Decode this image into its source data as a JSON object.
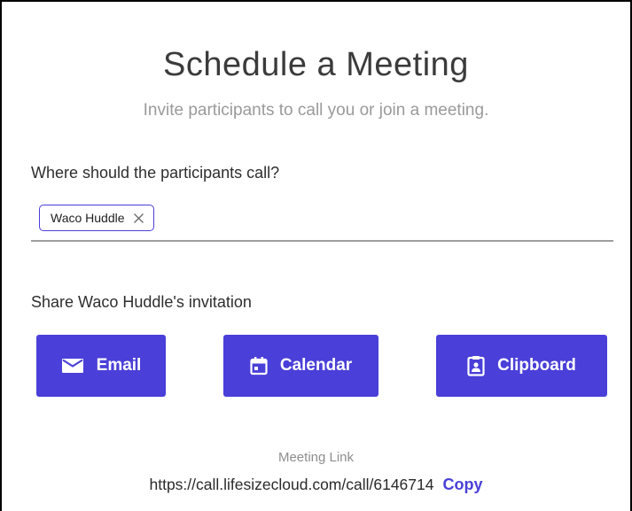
{
  "dialog": {
    "title": "Schedule a Meeting",
    "subtitle": "Invite participants to call you or join a meeting."
  },
  "location": {
    "question": "Where should the participants call?",
    "selected_room": "Waco Huddle",
    "remove_icon": "close-x-icon"
  },
  "share": {
    "heading": "Share Waco Huddle's invitation",
    "buttons": [
      {
        "label": "Email",
        "icon": "envelope-icon"
      },
      {
        "label": "Calendar",
        "icon": "calendar-icon"
      },
      {
        "label": "Clipboard",
        "icon": "clipboard-icon"
      }
    ]
  },
  "meeting_link": {
    "caption": "Meeting Link",
    "url": "https://call.lifesizecloud.com/call/6146714",
    "copy_label": "Copy"
  },
  "colors": {
    "accent": "#4a3fd8",
    "title_text": "#3b3b3b",
    "muted_text": "#9a9a9a",
    "field_underline": "#9e9e9e"
  }
}
